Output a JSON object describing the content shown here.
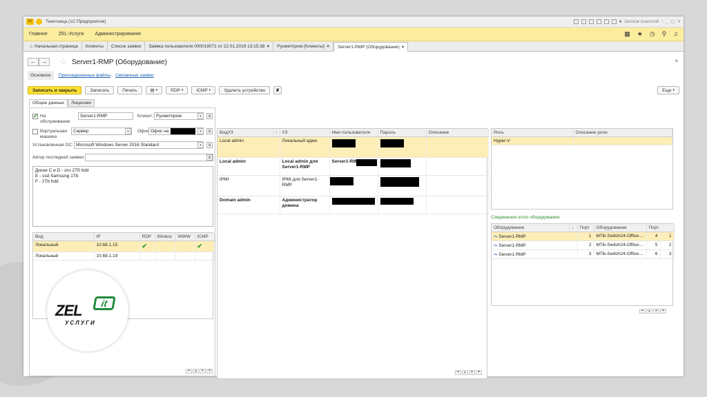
{
  "window": {
    "title": "Тикетница (1С:Предприятие)",
    "user": "Шилков Анатолий"
  },
  "menu": {
    "items": [
      "Главное",
      "ZEL-Услуги",
      "Администрирование"
    ]
  },
  "tabs": [
    {
      "label": "Начальная страница",
      "close": ""
    },
    {
      "label": "Клиенты",
      "close": ""
    },
    {
      "label": "Список заявок",
      "close": ""
    },
    {
      "label": "Заявка пользователя 000019071 от 22.01.2019 13:15:38",
      "close": "×"
    },
    {
      "label": "Русметпром (Клиенты)",
      "close": "×"
    },
    {
      "label": "Server1-RMP (Оборудование)",
      "close": "×"
    }
  ],
  "page": {
    "title": "Server1-RMP (Оборудование)",
    "subtabs": [
      "Основное",
      "Присоединенные файлы",
      "Связанные заявки"
    ]
  },
  "toolbar": {
    "save_close": "Записать и закрыть",
    "save": "Записать",
    "print": "Печать",
    "rdp": "RDP",
    "icmp": "ICMP",
    "remove": "Удалить устройство",
    "more": "Еще"
  },
  "form_tabs": [
    "Общие данные",
    "Лицензии"
  ],
  "general": {
    "on_service_label": "На обслуживании",
    "on_service_checked": true,
    "name": "Server1-RMP",
    "client_label": "Клиент:",
    "client": "Русметпром",
    "virtual_label": "Виртуальная машина",
    "virtual_checked": false,
    "type": "Сервер",
    "office_label": "Офис:",
    "office": "Офис на",
    "os_label": "Установленная ОС:",
    "os": "Microsoft Windows Server 2016 Standard",
    "last_author_label": "Автор последней заявки:",
    "last_author": "",
    "notes": [
      "Диски C и D - это 2Тб hdd",
      "E - ssd Samsung 1Tb",
      "F - 2Tb hdd"
    ]
  },
  "ip_table": {
    "headers": [
      "Вид",
      "IP",
      "RDP",
      "Winbox",
      "WWW",
      "ICMP"
    ],
    "rows": [
      {
        "kind": "Локальный",
        "ip": "10.68.1.15",
        "rdp": "✔",
        "winbox": "",
        "www": "",
        "icmp": "✔"
      },
      {
        "kind": "Локальный",
        "ip": "10.68.1.19",
        "rdp": "",
        "winbox": "",
        "www": "",
        "icmp": ""
      }
    ]
  },
  "accounts_table": {
    "headers": [
      "ВидУЗ",
      "↑",
      "УЗ",
      "Имя пользователя",
      "Пароль",
      "Описание"
    ],
    "rows": [
      {
        "kind": "Local admin",
        "account": "Локальный адмн",
        "user": "",
        "bold": false
      },
      {
        "kind": "Local admin",
        "account": "Local admin для Server1-RMP",
        "user": "Server1-RM",
        "bold": true
      },
      {
        "kind": "IPMI",
        "account": "IPMI для Server1-RMP",
        "user": "",
        "bold": false
      },
      {
        "kind": "Domain admin",
        "account": "Администратор домена",
        "user": "",
        "bold": true
      }
    ]
  },
  "roles_table": {
    "headers": [
      "Роль",
      "Описание роли"
    ],
    "rows": [
      {
        "role": "Hyper-V",
        "desc": ""
      }
    ]
  },
  "connections": {
    "caption": "Соединения этого оборудования:",
    "headers": [
      "Оборудование",
      "↓",
      "Порт",
      "Оборудование",
      "Порт"
    ],
    "rows": [
      {
        "eq": "Server1-RMP",
        "port": "1",
        "eq2": "MTik-Switch24-Office-...",
        "port2a": "4",
        "port2b": "1"
      },
      {
        "eq": "Server1-RMP",
        "port": "2",
        "eq2": "MTik-Switch24-Office-...",
        "port2a": "5",
        "port2b": "2"
      },
      {
        "eq": "Server1-RMP",
        "port": "3",
        "eq2": "MTik-Switch24-Office-...",
        "port2a": "6",
        "port2b": "3"
      }
    ]
  },
  "watermark": {
    "brand": "ZEL",
    "badge": "it",
    "tagline": "УСЛУГИ"
  },
  "colors": {
    "accent": "#fbe033",
    "menu_bg": "#fbed9e",
    "selected_row": "#fdeeb7",
    "link": "#1a5fb4",
    "caption": "#2a8a2a"
  }
}
